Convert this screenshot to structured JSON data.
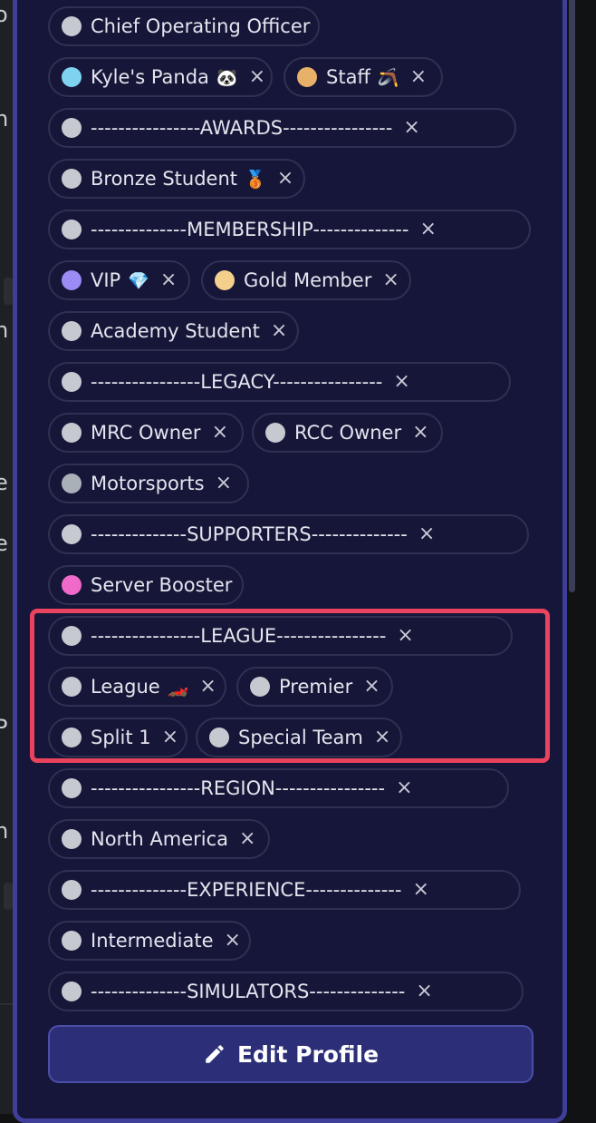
{
  "roles": [
    {
      "label": "Chief Operating Officer",
      "emoji": "",
      "dot": "#c7c9d1",
      "removable": false
    },
    {
      "label": "Kyle's Panda",
      "emoji": "🐼",
      "dot": "#7fd3f0",
      "removable": true
    },
    {
      "label": "Staff",
      "emoji": "🪃",
      "dot": "#e8b16a",
      "removable": true
    },
    {
      "label": "----------------AWARDS----------------",
      "emoji": "",
      "dot": "#c7c9d1",
      "removable": true
    },
    {
      "label": "Bronze Student",
      "emoji": "🥉",
      "dot": "#c7c9d1",
      "removable": true
    },
    {
      "label": "--------------MEMBERSHIP--------------",
      "emoji": "",
      "dot": "#c7c9d1",
      "removable": true
    },
    {
      "label": "VIP",
      "emoji": "💎",
      "dot": "#9b8cf5",
      "removable": true
    },
    {
      "label": "Gold Member",
      "emoji": "",
      "dot": "#f4d08c",
      "removable": true
    },
    {
      "label": "Academy Student",
      "emoji": "",
      "dot": "#c7c9d1",
      "removable": true
    },
    {
      "label": "----------------LEGACY----------------",
      "emoji": "",
      "dot": "#c7c9d1",
      "removable": true
    },
    {
      "label": "MRC Owner",
      "emoji": "",
      "dot": "#c7c9d1",
      "removable": true
    },
    {
      "label": "RCC Owner",
      "emoji": "",
      "dot": "#c7c9d1",
      "removable": true
    },
    {
      "label": "Motorsports",
      "emoji": "",
      "dot": "#a9b0b8",
      "removable": true
    },
    {
      "label": "--------------SUPPORTERS--------------",
      "emoji": "",
      "dot": "#c7c9d1",
      "removable": true
    },
    {
      "label": "Server Booster",
      "emoji": "",
      "dot": "#f06ac9",
      "removable": false
    },
    {
      "label": "----------------LEAGUE----------------",
      "emoji": "",
      "dot": "#c7c9d1",
      "removable": true
    },
    {
      "label": "League",
      "emoji": "🏎️",
      "dot": "#c7c9d1",
      "removable": true
    },
    {
      "label": "Premier",
      "emoji": "",
      "dot": "#c7c9d1",
      "removable": true
    },
    {
      "label": "Split 1",
      "emoji": "",
      "dot": "#c7c9d1",
      "removable": true
    },
    {
      "label": "Special Team",
      "emoji": "",
      "dot": "#c7c9d1",
      "removable": true
    },
    {
      "label": "----------------REGION----------------",
      "emoji": "",
      "dot": "#c7c9d1",
      "removable": true
    },
    {
      "label": "North America",
      "emoji": "",
      "dot": "#c7c9d1",
      "removable": true
    },
    {
      "label": "--------------EXPERIENCE--------------",
      "emoji": "",
      "dot": "#c7c9d1",
      "removable": true
    },
    {
      "label": "Intermediate",
      "emoji": "",
      "dot": "#c7c9d1",
      "removable": true
    },
    {
      "label": "--------------SIMULATORS--------------",
      "emoji": "",
      "dot": "#c7c9d1",
      "removable": true
    }
  ],
  "remove_icon": "×",
  "edit_button": {
    "label": "Edit Profile",
    "icon": "pencil-icon"
  },
  "colors": {
    "highlight": "#e9435e",
    "panel": "#16163a",
    "button": "#2c2f78"
  }
}
